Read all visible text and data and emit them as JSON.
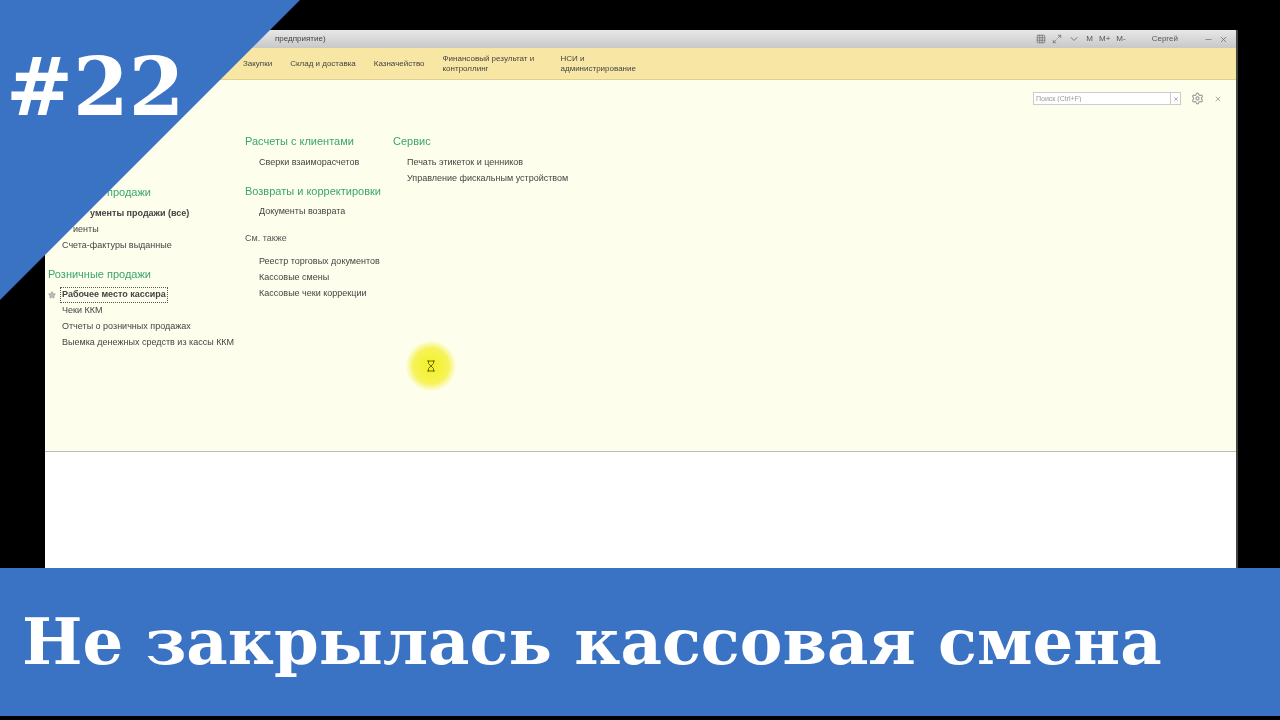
{
  "window": {
    "title": "предприятие)",
    "memory_keys": [
      "M",
      "M+",
      "M-"
    ],
    "user": "Сергей"
  },
  "sections": [
    {
      "label": "Закупки"
    },
    {
      "label": "Склад и доставка"
    },
    {
      "label": "Казначейство"
    },
    {
      "label": "Финансовый результат и контроллинг"
    },
    {
      "label": "НСИ и администрирование"
    }
  ],
  "search": {
    "placeholder": "Поиск (Ctrl+F)"
  },
  "columns": [
    [
      {
        "kind": "heading",
        "title": "продажи",
        "items": [
          {
            "label": "ументы продажи (все)",
            "bold": true,
            "favorite": false,
            "focused": false
          },
          {
            "label": "иенты",
            "bold": false,
            "favorite": false,
            "focused": false
          },
          {
            "label": "Счета-фактуры выданные",
            "bold": false,
            "favorite": false,
            "focused": false
          }
        ]
      },
      {
        "kind": "heading",
        "title": "Розничные продажи",
        "items": [
          {
            "label": "Рабочее место кассира",
            "bold": true,
            "favorite": true,
            "focused": true
          },
          {
            "label": "Чеки ККМ",
            "bold": false,
            "favorite": false,
            "focused": false
          },
          {
            "label": "Отчеты о розничных продажах",
            "bold": false,
            "favorite": false,
            "focused": false
          },
          {
            "label": "Выемка денежных средств из кассы ККМ",
            "bold": false,
            "favorite": false,
            "focused": false
          }
        ]
      }
    ],
    [
      {
        "kind": "heading",
        "title": "Расчеты с клиентами",
        "items": [
          {
            "label": "Сверки взаиморасчетов",
            "bold": false,
            "favorite": false,
            "focused": false
          }
        ]
      },
      {
        "kind": "heading",
        "title": "Возвраты и корректировки",
        "items": [
          {
            "label": "Документы возврата",
            "bold": false,
            "favorite": false,
            "focused": false
          }
        ]
      },
      {
        "kind": "see_also",
        "title": "См. также",
        "items": [
          {
            "label": "Реестр торговых документов",
            "bold": false,
            "favorite": false,
            "focused": false
          },
          {
            "label": "Кассовые смены",
            "bold": false,
            "favorite": false,
            "focused": false
          },
          {
            "label": "Кассовые чеки коррекции",
            "bold": false,
            "favorite": false,
            "focused": false
          }
        ]
      }
    ],
    [
      {
        "kind": "heading",
        "title": "Сервис",
        "items": [
          {
            "label": "Печать этикеток и ценников",
            "bold": false,
            "favorite": false,
            "focused": false
          },
          {
            "label": "Управление фискальным устройством",
            "bold": false,
            "favorite": false,
            "focused": false
          }
        ]
      }
    ]
  ],
  "overlay": {
    "episode": "#22",
    "headline": "Не закрылась кассовая смена"
  }
}
